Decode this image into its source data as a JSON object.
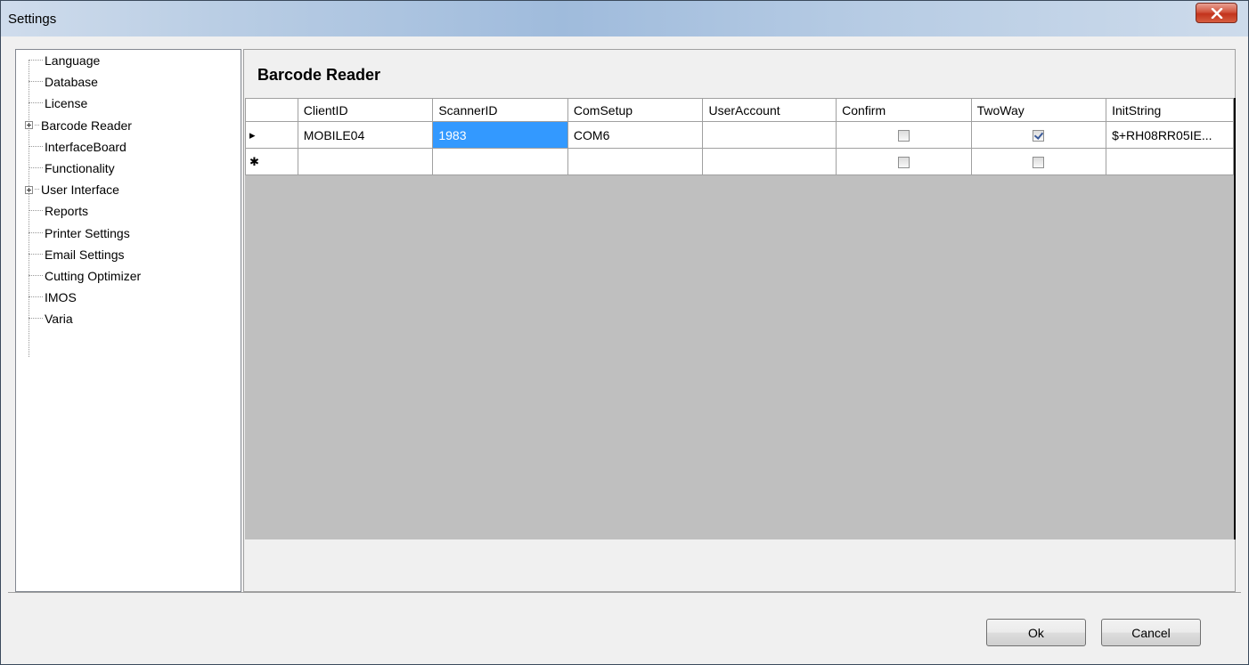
{
  "window": {
    "title": "Settings"
  },
  "tree": {
    "items": [
      {
        "label": "Language",
        "expandable": false
      },
      {
        "label": "Database",
        "expandable": false
      },
      {
        "label": "License",
        "expandable": false
      },
      {
        "label": "Barcode Reader",
        "expandable": true
      },
      {
        "label": "InterfaceBoard",
        "expandable": false
      },
      {
        "label": "Functionality",
        "expandable": false
      },
      {
        "label": "User Interface",
        "expandable": true
      },
      {
        "label": "Reports",
        "expandable": false
      },
      {
        "label": "Printer Settings",
        "expandable": false
      },
      {
        "label": "Email Settings",
        "expandable": false
      },
      {
        "label": "Cutting Optimizer",
        "expandable": false
      },
      {
        "label": "IMOS",
        "expandable": false
      },
      {
        "label": "Varia",
        "expandable": false
      }
    ]
  },
  "panel": {
    "title": "Barcode Reader",
    "columns": [
      "ClientID",
      "ScannerID",
      "ComSetup",
      "UserAccount",
      "Confirm",
      "TwoWay",
      "InitString"
    ],
    "rows": [
      {
        "indicator": "▸",
        "ClientID": "MOBILE04",
        "ScannerID": "1983",
        "ComSetup": "COM6",
        "UserAccount": "",
        "Confirm": false,
        "TwoWay": true,
        "InitString": "$+RH08RR05IE..."
      },
      {
        "indicator": "✱",
        "ClientID": "",
        "ScannerID": "",
        "ComSetup": "",
        "UserAccount": "",
        "Confirm": false,
        "TwoWay": false,
        "InitString": ""
      }
    ]
  },
  "buttons": {
    "ok": "Ok",
    "cancel": "Cancel"
  },
  "colors": {
    "selection": "#3399ff",
    "grid_background": "#bfbfbf",
    "close_button": "#c2331c"
  }
}
